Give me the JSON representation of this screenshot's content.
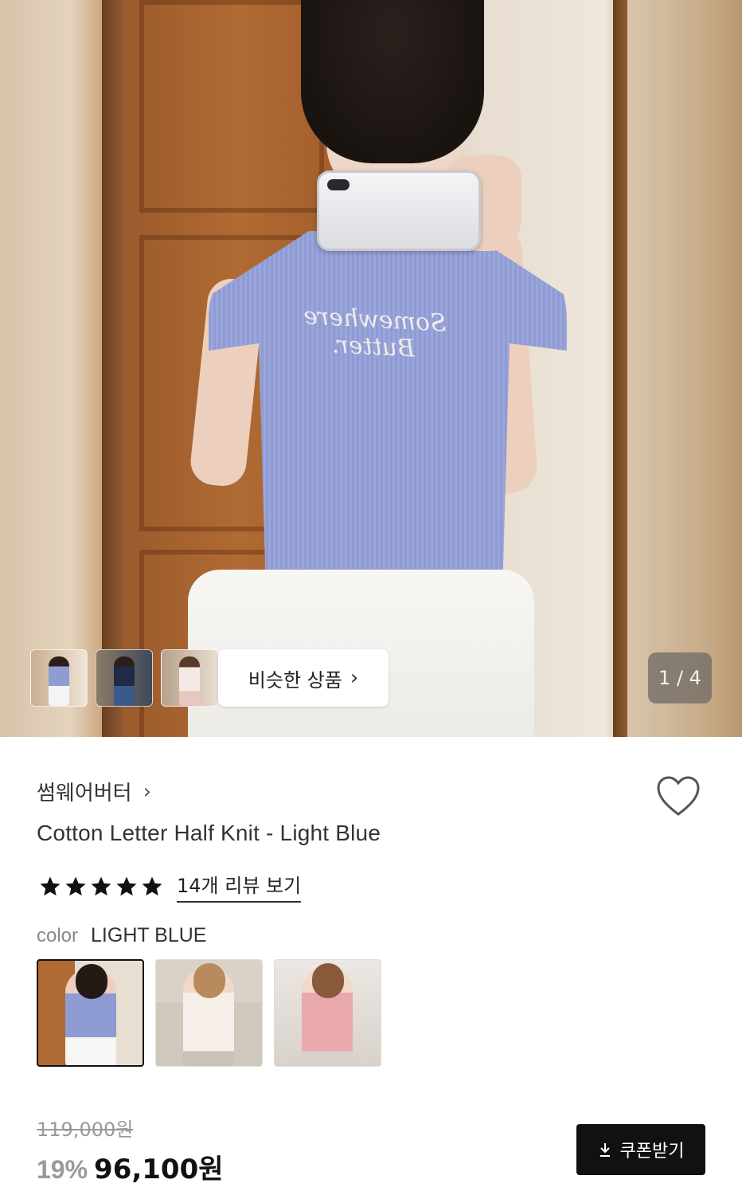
{
  "gallery": {
    "similar_label": "비슷한 상품",
    "counter": "1 / 4",
    "shirt_print": "Somewhere Butter."
  },
  "product": {
    "brand": "썸웨어버터",
    "title": "Cotton Letter Half Knit - Light Blue",
    "rating_stars": 5,
    "reviews_link": "14개 리뷰 보기",
    "color_label": "color",
    "color_value": "LIGHT BLUE",
    "original_price": "119,000원",
    "discount": "19%",
    "price": "96,100원",
    "coupon_label": "쿠폰받기"
  },
  "icons": {
    "heart": "heart-icon",
    "star": "star-icon",
    "chevron": "chevron-right-icon",
    "download": "download-icon"
  },
  "colors": {
    "shirt_blue": "#8f9bd3",
    "swatch_white": "#f6eee8",
    "swatch_pink": "#e9a9ad",
    "button_black": "#111111"
  }
}
